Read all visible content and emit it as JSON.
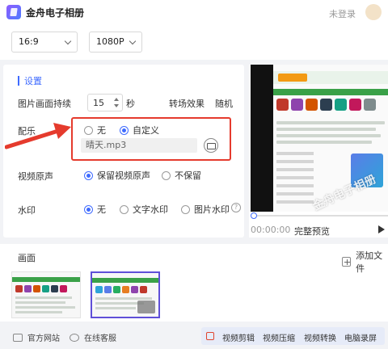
{
  "app": {
    "title": "金舟电子相册",
    "login": "未登录"
  },
  "toolbar": {
    "aspect": "16:9",
    "resolution": "1080P"
  },
  "settings": {
    "title": "设置",
    "duration_label": "图片画面持续",
    "duration_value": "15",
    "duration_unit": "秒",
    "transition_label": "转场效果",
    "transition_value": "随机",
    "music_label": "配乐",
    "music_none": "无",
    "music_custom": "自定义",
    "music_selected": "自定义",
    "music_file": "晴天.mp3",
    "original_audio_label": "视频原声",
    "original_audio_keep": "保留视频原声",
    "original_audio_drop": "不保留",
    "original_audio_selected": "保留视频原声",
    "watermark_label": "水印",
    "watermark_none": "无",
    "watermark_text": "文字水印",
    "watermark_image": "图片水印",
    "watermark_selected": "无",
    "accent": "#3f6bff",
    "highlight_color": "#e53b2d"
  },
  "preview": {
    "time": "00:00:00",
    "fullscreen": "完整预览",
    "watermark_overlay": "金舟电子相册"
  },
  "frames": {
    "title": "画面",
    "add_button": "添加文件"
  },
  "footer": {
    "official_site": "官方网站",
    "online_service": "在线客服",
    "tools": [
      "视频剪辑",
      "视频压缩",
      "视频转换",
      "电脑录屏"
    ]
  }
}
